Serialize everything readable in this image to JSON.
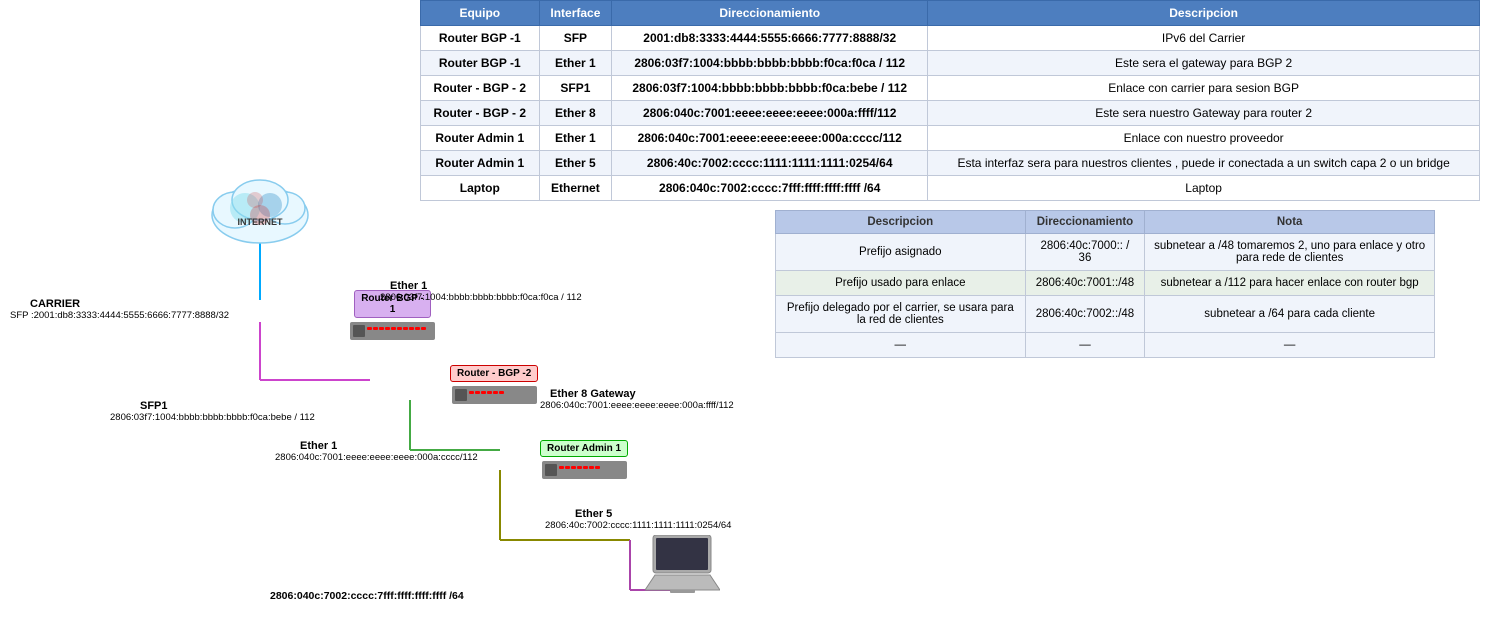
{
  "mainTable": {
    "headers": [
      "Equipo",
      "Interface",
      "Direccionamiento",
      "Descripcion"
    ],
    "rows": [
      {
        "equipo": "Router BGP -1",
        "interface": "SFP",
        "direccionamiento": "2001:db8:3333:4444:5555:6666:7777:8888/32",
        "descripcion": "IPv6 del Carrier"
      },
      {
        "equipo": "Router BGP -1",
        "interface": "Ether 1",
        "direccionamiento": "2806:03f7:1004:bbbb:bbbb:bbbb:f0ca:f0ca / 112",
        "descripcion": "Este sera el gateway para BGP 2"
      },
      {
        "equipo": "Router - BGP - 2",
        "interface": "SFP1",
        "direccionamiento": "2806:03f7:1004:bbbb:bbbb:bbbb:f0ca:bebe / 112",
        "descripcion": "Enlace con carrier para sesion BGP"
      },
      {
        "equipo": "Router - BGP - 2",
        "interface": "Ether 8",
        "direccionamiento": "2806:040c:7001:eeee:eeee:eeee:000a:ffff/112",
        "descripcion": "Este sera nuestro Gateway para router 2"
      },
      {
        "equipo": "Router Admin 1",
        "interface": "Ether 1",
        "direccionamiento": "2806:040c:7001:eeee:eeee:eeee:000a:cccc/112",
        "descripcion": "Enlace con nuestro proveedor"
      },
      {
        "equipo": "Router Admin 1",
        "interface": "Ether 5",
        "direccionamiento": "2806:40c:7002:cccc:1111:1111:1111:0254/64",
        "descripcion": "Esta interfaz sera para nuestros clientes , puede ir conectada a un switch capa 2 o un bridge"
      },
      {
        "equipo": "Laptop",
        "interface": "Ethernet",
        "direccionamiento": "2806:040c:7002:cccc:7fff:ffff:ffff:ffff /64",
        "descripcion": "Laptop"
      }
    ]
  },
  "secondTable": {
    "headers": [
      "Descripcion",
      "Direccionamiento",
      "Nota"
    ],
    "rows": [
      {
        "desc": "Prefijo asignado",
        "dir": "2806:40c:7000:: / 36",
        "nota": "subnetear a /48  tomaremos 2, uno para enlace y otro para rede de clientes"
      },
      {
        "desc": "Prefijo usado para enlace",
        "dir": "2806:40c:7001::/48",
        "nota": "subnetear a /112 para hacer enlace con router bgp"
      },
      {
        "desc": "Prefijo delegado por el carrier, se usara para la red de clientes",
        "dir": "2806:40c:7002::/48",
        "nota": "subnetear a /64 para cada cliente"
      },
      {
        "desc": "—",
        "dir": "—",
        "nota": "—"
      }
    ]
  },
  "diagram": {
    "internetLabel": "INTERNET",
    "carrierLabel": "CARRIER",
    "carrierSfp": "SFP :2001:db8:3333:4444:5555:6666:7777:8888/32",
    "routerBgp1Label": "Router BGP -\n1",
    "routerBgp1Ether1Label": "Ether 1",
    "routerBgp1Ether1Addr": "2806:03f7:1004:bbbb:bbbb:bbbb:f0ca:f0ca / 112",
    "routerBgp2Label": "Router - BGP -2",
    "routerBgp2Sfp1Label": "SFP1",
    "routerBgp2Sfp1Addr": "2806:03f7:1004:bbbb:bbbb:bbbb:f0ca:bebe / 112",
    "routerBgp2Ether8Label": "Ether 8 Gateway",
    "routerBgp2Ether8Addr": "2806:040c:7001:eeee:eeee:eeee:000a:ffff/112",
    "routerAdmin1Label": "Router Admin 1",
    "routerAdmin1Ether1Label": "Ether 1",
    "routerAdmin1Ether1Addr": "2806:040c:7001:eeee:eeee:eeee:000a:cccc/112",
    "routerAdmin1Ether5Label": "Ether 5",
    "routerAdmin1Ether5Addr": "2806:40c:7002:cccc:1111:1111:1111:0254/64",
    "laptopAddr": "2806:040c:7002:cccc:7fff:ffff:ffff:ffff /64"
  }
}
